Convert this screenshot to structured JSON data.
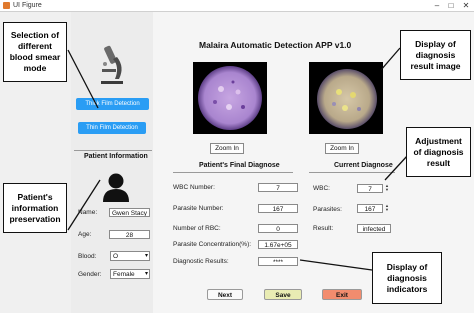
{
  "window": {
    "title": "UI Figure",
    "controls": [
      "–",
      "□",
      "✕"
    ]
  },
  "app_title": "Malaira Automatic Detection APP v1.0",
  "mode_buttons": {
    "thick": "Thick Film Detection",
    "thin": "Thin Film Detection"
  },
  "patient_info": {
    "title": "Patient Information",
    "name_label": "Name:",
    "name_value": "Gwen Stacy",
    "age_label": "Age:",
    "age_value": "28",
    "blood_label": "Blood:",
    "blood_value": "O",
    "gender_label": "Gender:",
    "gender_value": "Female"
  },
  "zoom_label": "Zoom In",
  "final_diagnose": {
    "title": "Patient's Final Diagnose",
    "rows": [
      {
        "label": "WBC Number:",
        "value": "7"
      },
      {
        "label": "Parasite Number:",
        "value": "167"
      },
      {
        "label": "Number of RBC:",
        "value": "0"
      },
      {
        "label": "Parasite Concentration(%):",
        "value": "1.67e+05"
      },
      {
        "label": "Diagnostic Results:",
        "value": "****"
      }
    ]
  },
  "current_diagnose": {
    "title": "Current Diagnose",
    "wbc_label": "WBC:",
    "wbc_value": "7",
    "parasites_label": "Parasites:",
    "parasites_value": "167",
    "result_label": "Result:",
    "result_value": "infected"
  },
  "bottom_buttons": {
    "next": "Next",
    "save": "Save",
    "exit": "Exit"
  },
  "callouts": {
    "smear_mode": [
      "Selection of",
      "different",
      "blood smear",
      "mode"
    ],
    "patient_info": [
      "Patient's",
      "information",
      "preservation"
    ],
    "result_image": [
      "Display of",
      "diagnosis",
      "result image"
    ],
    "adjustment": [
      "Adjustment",
      "of diagnosis",
      "result"
    ],
    "indicators": [
      "Display of",
      "diagnosis",
      "indicators"
    ]
  },
  "colors": {
    "blue_button": "#2a9df4",
    "save_button": "#e9ecb3",
    "exit_button": "#f28c6e"
  }
}
